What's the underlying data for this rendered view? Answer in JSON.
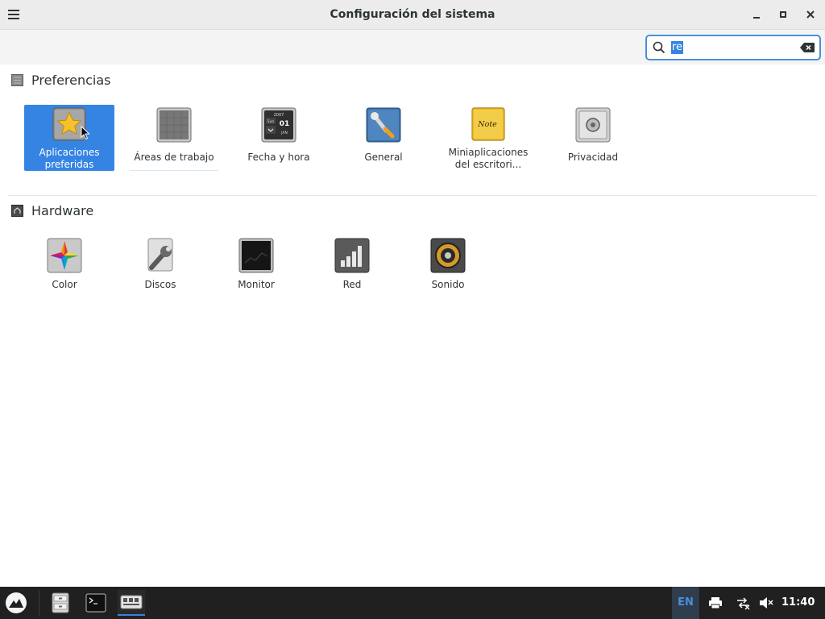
{
  "window": {
    "title": "Configuración del sistema"
  },
  "search": {
    "value": "re"
  },
  "sections": {
    "preferences": {
      "title": "Preferencias",
      "items": [
        {
          "label": "Aplicaciones preferidas",
          "icon": "star-icon"
        },
        {
          "label": "Áreas de trabajo",
          "icon": "workspaces-icon"
        },
        {
          "label": "Fecha y hora",
          "icon": "calendar-icon",
          "calendar_year": "2007",
          "calendar_day_name": "Sun",
          "calendar_day": "01",
          "calendar_month": "JAN"
        },
        {
          "label": "General",
          "icon": "wrench-screwdriver-icon"
        },
        {
          "label": "Miniaplicaciones del escritori...",
          "icon": "note-icon",
          "note_text": "Note"
        },
        {
          "label": "Privacidad",
          "icon": "safe-icon"
        }
      ]
    },
    "hardware": {
      "title": "Hardware",
      "items": [
        {
          "label": "Color",
          "icon": "color-wheel-icon"
        },
        {
          "label": "Discos",
          "icon": "disk-wrench-icon"
        },
        {
          "label": "Monitor",
          "icon": "monitor-icon"
        },
        {
          "label": "Red",
          "icon": "network-signal-icon"
        },
        {
          "label": "Sonido",
          "icon": "speaker-icon"
        }
      ]
    }
  },
  "taskbar": {
    "language": "EN",
    "clock": "11:40"
  },
  "colors": {
    "accent": "#3584e4",
    "taskbar": "#202020",
    "titlebar": "#ececec"
  }
}
